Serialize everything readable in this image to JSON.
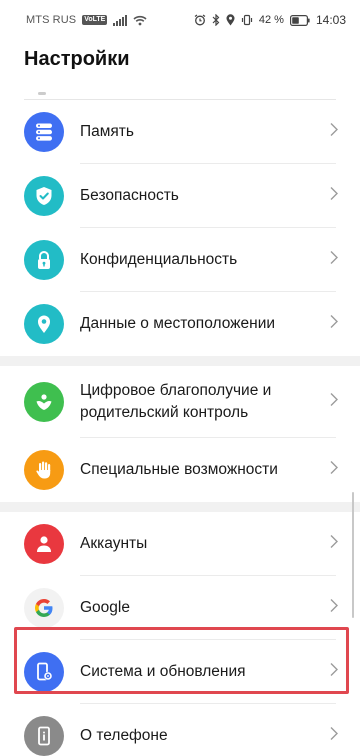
{
  "status_bar": {
    "carrier": "MTS RUS",
    "volte": "VoLTE",
    "battery_percent": "42 %",
    "time": "14:03"
  },
  "title": "Настройки",
  "rows": [
    {
      "label": "Память",
      "icon": "storage-icon",
      "color": "#3f6ff2"
    },
    {
      "label": "Безопасность",
      "icon": "shield-icon",
      "color": "#22bcc6"
    },
    {
      "label": "Конфиденциальность",
      "icon": "lock-icon",
      "color": "#22bcc6"
    },
    {
      "label": "Данные о местоположении",
      "icon": "location-pin-icon",
      "color": "#22bcc6"
    },
    {
      "label": "Цифровое благополучие и родительский контроль",
      "icon": "digital-wellbeing-icon",
      "color": "#3fbf4f"
    },
    {
      "label": "Специальные возможности",
      "icon": "hand-icon",
      "color": "#f79b13"
    },
    {
      "label": "Аккаунты",
      "icon": "user-icon",
      "color": "#e9383f"
    },
    {
      "label": "Google",
      "icon": "google-icon",
      "color": "#ffffff"
    },
    {
      "label": "Система и обновления",
      "icon": "system-phone-gear-icon",
      "color": "#3f6ff2"
    },
    {
      "label": "О телефоне",
      "icon": "phone-info-icon",
      "color": "#8a8a8a"
    }
  ],
  "highlight_color": "#e0474f"
}
